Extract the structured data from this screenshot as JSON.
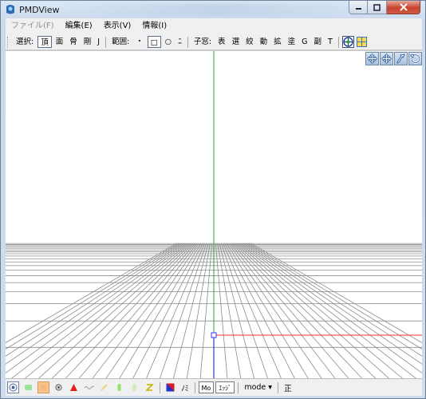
{
  "window": {
    "title": "PMDView"
  },
  "menubar": {
    "items": [
      {
        "label": "ファイル(F)",
        "disabled": true
      },
      {
        "label": "編集(E)",
        "disabled": false
      },
      {
        "label": "表示(V)",
        "disabled": false
      },
      {
        "label": "情報(I)",
        "disabled": false
      }
    ]
  },
  "toolbar": {
    "select_label": "選択:",
    "select_items": [
      "頂",
      "面",
      "骨",
      "剛",
      "J"
    ],
    "range_label": "範囲:",
    "range_items": [
      "・",
      "□",
      "○",
      "ﾆ"
    ],
    "sub_label": "子窓:",
    "sub_items": [
      "表",
      "選",
      "絞",
      "動",
      "拡",
      "塗",
      "G",
      "副",
      "T"
    ],
    "icons": [
      "view-target-icon",
      "grid-split-icon"
    ]
  },
  "viewport": {
    "nav_tools": [
      "move-icon",
      "pan-icon",
      "zoom-icon",
      "rotate-icon"
    ],
    "colors": {
      "x_axis": "#ff3030",
      "y_axis": "#22aa22",
      "z_axis": "#3030ff",
      "grid": "#8c8c8c"
    }
  },
  "statusbar": {
    "icons": [
      "camera-icon",
      "light-icon",
      "material-icon",
      "point-icon",
      "triangle-icon",
      "wave-icon",
      "bone-icon",
      "ik-icon",
      "rigid-icon",
      "joint-icon"
    ],
    "color_icon": "color-swatch-icon",
    "label_nomi": "ﾉﾐ",
    "btn_mo": "Mo",
    "btn_edge": "ｴｯｼﾞ",
    "mode_label": "mode",
    "mode_arrow": "▾",
    "sei_label": "正"
  }
}
